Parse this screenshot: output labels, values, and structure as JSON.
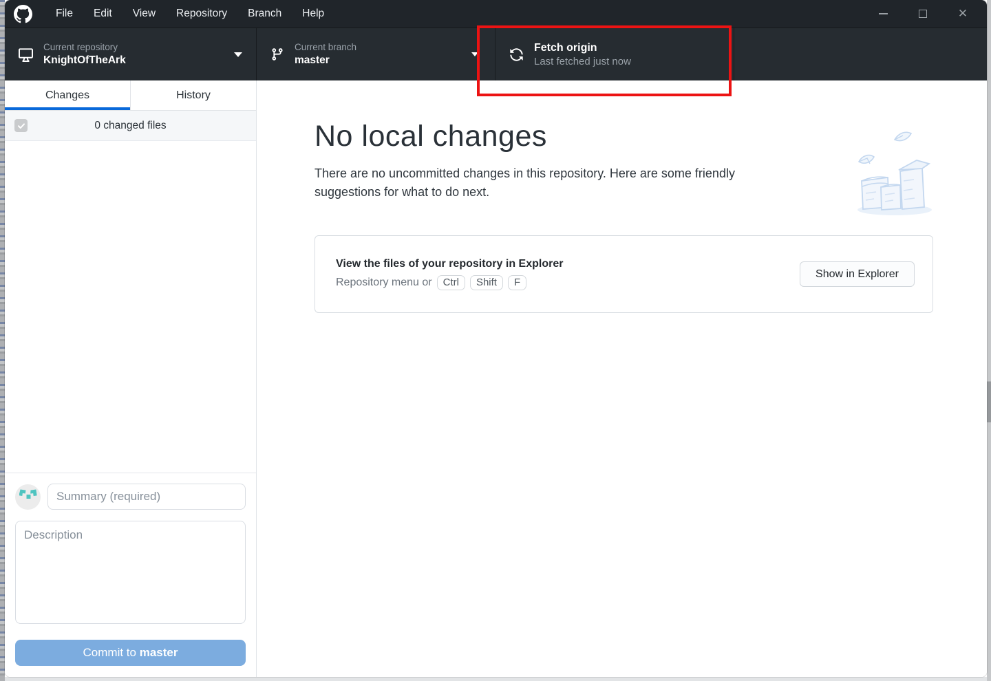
{
  "window": {
    "controls": {
      "minimize": "minimize",
      "maximize": "maximize",
      "close_glyph": "✕"
    }
  },
  "menu_bar": {
    "items": [
      "File",
      "Edit",
      "View",
      "Repository",
      "Branch",
      "Help"
    ]
  },
  "toolbar": {
    "repository": {
      "label": "Current repository",
      "value": "KnightOfTheArk"
    },
    "branch": {
      "label": "Current branch",
      "value": "master"
    },
    "fetch": {
      "title": "Fetch origin",
      "subtitle": "Last fetched just now"
    }
  },
  "sidebar": {
    "tabs": [
      {
        "label": "Changes",
        "active": true
      },
      {
        "label": "History",
        "active": false
      }
    ],
    "changed_files_label": "0 changed files",
    "commit_form": {
      "summary_placeholder": "Summary (required)",
      "description_placeholder": "Description",
      "commit_button_prefix": "Commit to ",
      "commit_button_branch": "master"
    }
  },
  "main": {
    "title": "No local changes",
    "subtitle": "There are no uncommitted changes in this repository. Here are some friendly suggestions for what to do next.",
    "suggestion_card": {
      "title": "View the files of your repository in Explorer",
      "hint_prefix": "Repository menu or",
      "shortcut_keys": [
        "Ctrl",
        "Shift",
        "F"
      ],
      "action_label": "Show in Explorer"
    }
  },
  "annotation": {
    "shape": "red-rectangle-highlight-around-fetch-origin",
    "color": "#ec1313"
  },
  "colors": {
    "titlebar_bg": "#20252a",
    "toolbar_bg": "#262c31",
    "active_tab_underline": "#0969da",
    "commit_button_bg": "#7cacdf",
    "avatar_identicon": "#4fc4c0",
    "annotation_red": "#ec1313"
  }
}
